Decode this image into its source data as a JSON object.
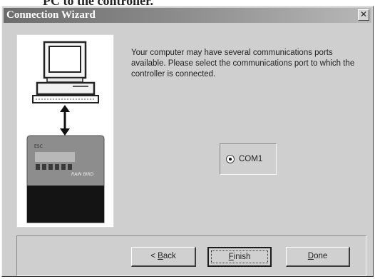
{
  "caption_fragment": "PC to the controller.",
  "window": {
    "title": "Connection Wizard",
    "close_glyph": "✕"
  },
  "message": "Your computer may have several communications ports available. Please select the communications port to which the controller is connected.",
  "ports": {
    "options": [
      "COM1"
    ],
    "selected": "COM1"
  },
  "controller": {
    "model_text": "ESC",
    "brand_text": "RAIN BIRD"
  },
  "buttons": {
    "back": {
      "accel": "B",
      "rest": "ack",
      "prefix": "< "
    },
    "finish": {
      "accel": "F",
      "rest": "inish"
    },
    "done": {
      "accel": "D",
      "rest": "one"
    }
  },
  "icons": {
    "close": "close-icon",
    "computer": "computer-icon",
    "arrow": "double-arrow-icon",
    "controller": "controller-icon"
  }
}
